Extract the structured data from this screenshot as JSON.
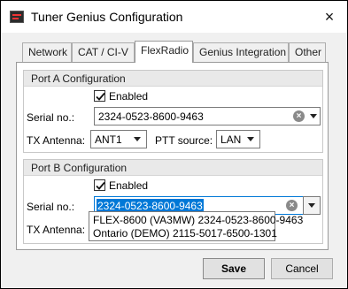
{
  "window": {
    "title": "Tuner Genius Configuration"
  },
  "tabs": [
    {
      "label": "Network"
    },
    {
      "label": "CAT / CI-V"
    },
    {
      "label": "FlexRadio"
    },
    {
      "label": "Genius Integration"
    },
    {
      "label": "Other"
    }
  ],
  "active_tab": "FlexRadio",
  "port_a": {
    "title": "Port A Configuration",
    "enabled_label": "Enabled",
    "enabled": true,
    "serial_label": "Serial no.:",
    "serial_value": "2324-0523-8600-9463",
    "tx_antenna_label": "TX Antenna:",
    "tx_antenna_value": "ANT1",
    "ptt_source_label": "PTT source:",
    "ptt_source_value": "LAN"
  },
  "port_b": {
    "title": "Port B Configuration",
    "enabled_label": "Enabled",
    "enabled": true,
    "serial_label": "Serial no.:",
    "serial_value": "2324-0523-8600-9463",
    "tx_antenna_label": "TX Antenna:",
    "dropdown_options": [
      "FLEX-8600 (VA3MW) 2324-0523-8600-9463",
      "Ontario (DEMO) 2115-5017-6500-1301"
    ]
  },
  "buttons": {
    "save": "Save",
    "cancel": "Cancel"
  },
  "icons": {
    "close": "×",
    "clear": "×"
  }
}
